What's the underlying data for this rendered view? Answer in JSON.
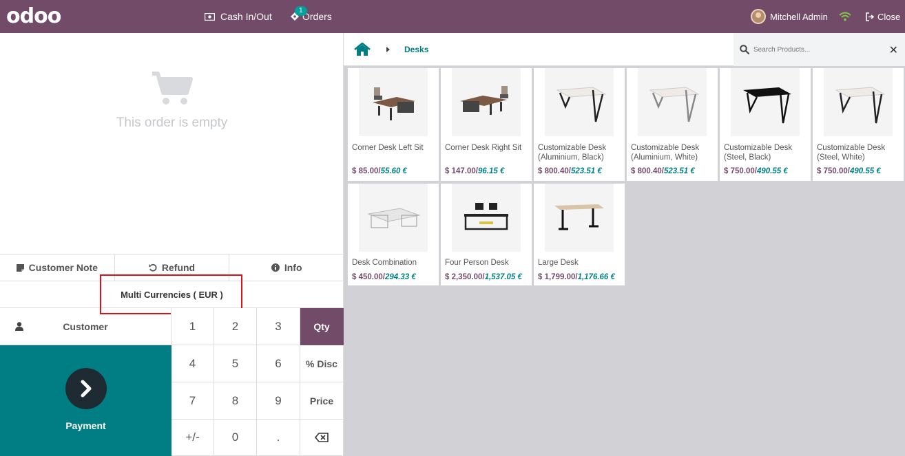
{
  "topbar": {
    "logo": "odoo",
    "cash_label": "Cash In/Out",
    "orders_label": "Orders",
    "orders_badge": "1",
    "user_name": "Mitchell Admin",
    "close_label": "Close"
  },
  "order": {
    "empty_text": "This order is empty"
  },
  "controls": {
    "customer_note": "Customer Note",
    "refund": "Refund",
    "info": "Info",
    "multi_currency": "Multi Currencies ( EUR )"
  },
  "actions": {
    "customer": "Customer",
    "payment": "Payment"
  },
  "numpad": [
    "1",
    "2",
    "3",
    "Qty",
    "4",
    "5",
    "6",
    "% Disc",
    "7",
    "8",
    "9",
    "Price",
    "+/-",
    "0",
    "."
  ],
  "breadcrumb": {
    "category": "Desks"
  },
  "search": {
    "placeholder": "Search Products..."
  },
  "products": [
    {
      "name": "Corner Desk Left Sit",
      "usd": "$ 85.00",
      "eur": "55.60 €"
    },
    {
      "name": "Corner Desk Right Sit",
      "usd": "$ 147.00",
      "eur": "96.15 €"
    },
    {
      "name": "Customizable Desk (Aluminium, Black)",
      "usd": "$ 800.40",
      "eur": "523.51 €"
    },
    {
      "name": "Customizable Desk (Aluminium, White)",
      "usd": "$ 800.40",
      "eur": "523.51 €"
    },
    {
      "name": "Customizable Desk (Steel, Black)",
      "usd": "$ 750.00",
      "eur": "490.55 €"
    },
    {
      "name": "Customizable Desk (Steel, White)",
      "usd": "$ 750.00",
      "eur": "490.55 €"
    },
    {
      "name": "Desk Combination",
      "usd": "$ 450.00",
      "eur": "294.33 €"
    },
    {
      "name": "Four Person Desk",
      "usd": "$ 2,350.00",
      "eur": "1,537.05 €"
    },
    {
      "name": "Large Desk",
      "usd": "$ 1,799.00",
      "eur": "1,176.66 €"
    }
  ],
  "colors": {
    "brand": "#714b67",
    "teal": "#017e84",
    "highlight": "#e0101a"
  }
}
